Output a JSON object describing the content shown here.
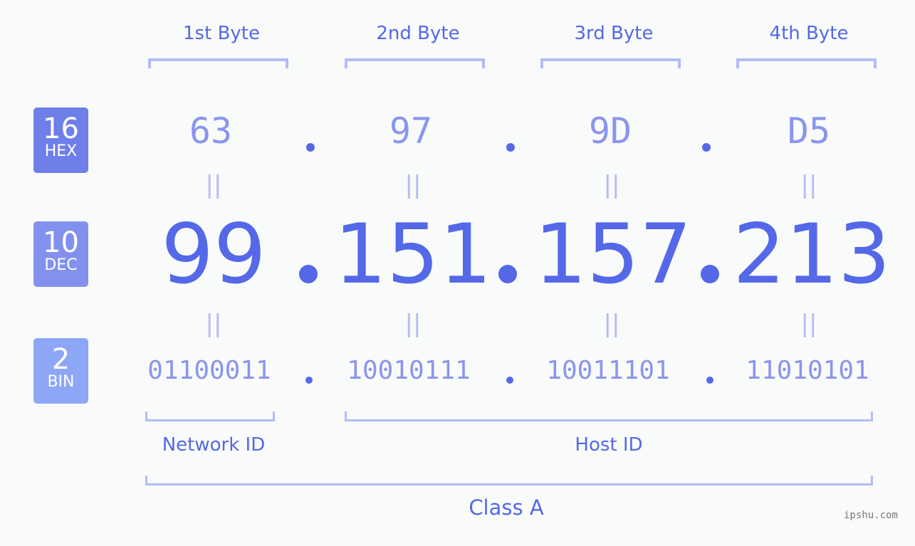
{
  "badges": [
    {
      "base": "16",
      "label": "HEX",
      "color": "#6f7fe9"
    },
    {
      "base": "10",
      "label": "DEC",
      "color": "#8291ee"
    },
    {
      "base": "2",
      "label": "BIN",
      "color": "#8da6f6"
    }
  ],
  "bytes": [
    {
      "label": "1st Byte",
      "hex": "63",
      "dec": "99",
      "bin": "01100011"
    },
    {
      "label": "2nd Byte",
      "hex": "97",
      "dec": "151",
      "bin": "10010111"
    },
    {
      "label": "3rd Byte",
      "hex": "9D",
      "dec": "157",
      "bin": "10011101"
    },
    {
      "label": "4th Byte",
      "hex": "D5",
      "dec": "213",
      "bin": "11010101"
    }
  ],
  "equals_symbol": "||",
  "network_id_label": "Network ID",
  "host_id_label": "Host ID",
  "class_label": "Class A",
  "watermark": "ipshu.com",
  "colors": {
    "primary": "#5468e8",
    "light": "#8a95ee",
    "bracket": "#b3bcf6",
    "background": "#f9fbfa"
  }
}
